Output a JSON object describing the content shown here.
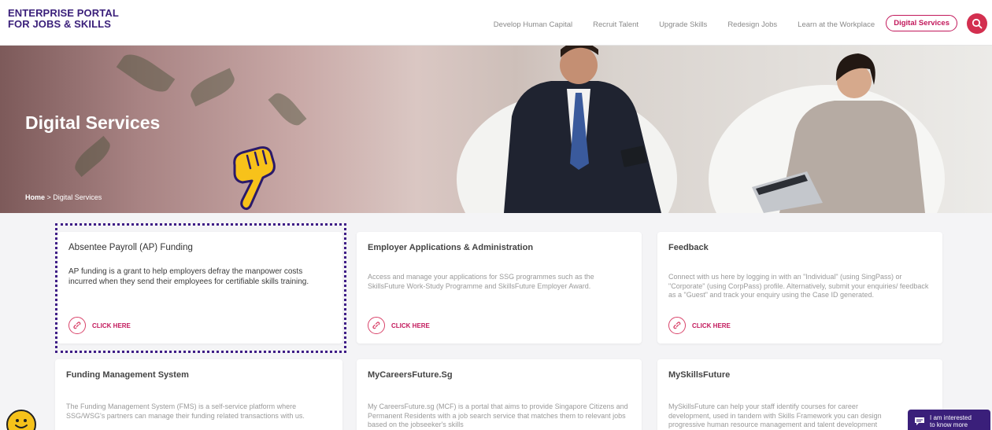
{
  "header": {
    "logo_line1": "ENTERPRISE PORTAL",
    "logo_line2": "FOR JOBS & SKILLS",
    "nav": [
      "Develop Human Capital",
      "Recruit Talent",
      "Upgrade Skills",
      "Redesign Jobs",
      "Learn at the Workplace"
    ],
    "nav_highlight": "Digital Services"
  },
  "hero": {
    "title": "Digital Services",
    "breadcrumb_home": "Home",
    "breadcrumb_sep": " > ",
    "breadcrumb_current": "Digital Services"
  },
  "cards": [
    {
      "title": "Absentee Payroll (AP) Funding",
      "desc": "AP funding is a grant to help employers defray the manpower costs incurred when they send their employees for certifiable skills training.",
      "cta": "CLICK HERE"
    },
    {
      "title": "Employer Applications & Administration",
      "desc": "Access and manage your applications for SSG programmes such as the SkillsFuture Work-Study Programme and SkillsFuture Employer Award.",
      "cta": "CLICK HERE"
    },
    {
      "title": "Feedback",
      "desc": "Connect with us here by logging in with an \"Individual\" (using SingPass) or \"Corporate\" (using CorpPass) profile. Alternatively, submit your enquiries/ feedback as a \"Guest\" and track your enquiry using the Case ID generated.",
      "cta": "CLICK HERE"
    },
    {
      "title": "Funding Management System",
      "desc": "The Funding Management System (FMS) is a self-service platform where SSG/WSG's partners can manage their funding related transactions with us."
    },
    {
      "title": "MyCareersFuture.Sg",
      "desc": "My CareersFuture.sg (MCF) is a portal that aims to provide Singapore Citizens and Permanent Residents with a job search service that matches them to relevant jobs based on the jobseeker's skills"
    },
    {
      "title": "MySkillsFuture",
      "desc": "MySkillsFuture can help your staff identify courses for career development, used in tandem with Skills Framework you can design progressive human resource management and talent development plans."
    }
  ],
  "interest": {
    "line1": "I am interested",
    "line2": "to know more"
  },
  "colors": {
    "brand": "#3a1f7a",
    "accent": "#c2185b",
    "search": "#d32f4f"
  }
}
